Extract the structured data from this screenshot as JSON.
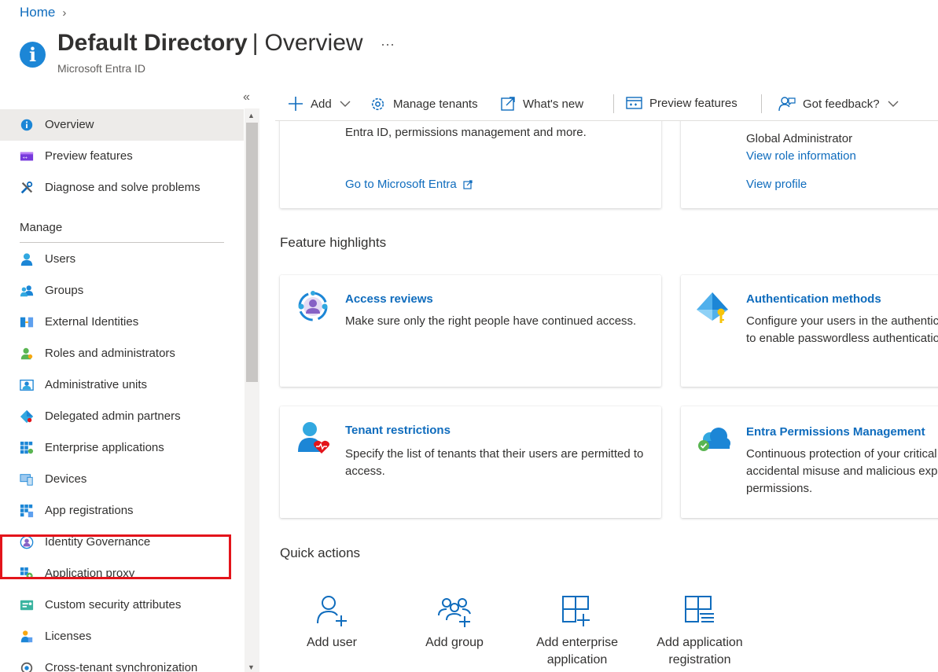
{
  "breadcrumb": {
    "home": "Home",
    "separator": "›"
  },
  "header": {
    "title_bold": "Default Directory",
    "title_pipe": "|",
    "title_rest": "Overview",
    "more": "···",
    "subtitle": "Microsoft Entra ID"
  },
  "sidebar": {
    "collapse": "«",
    "items": [
      {
        "label": "Overview",
        "icon": "info-icon"
      },
      {
        "label": "Preview features",
        "icon": "preview-icon"
      },
      {
        "label": "Diagnose and solve problems",
        "icon": "wrench-icon"
      }
    ],
    "manage_heading": "Manage",
    "manage_items": [
      {
        "label": "Users",
        "icon": "user-icon"
      },
      {
        "label": "Groups",
        "icon": "groups-icon"
      },
      {
        "label": "External Identities",
        "icon": "external-identities-icon"
      },
      {
        "label": "Roles and administrators",
        "icon": "roles-icon"
      },
      {
        "label": "Administrative units",
        "icon": "admin-units-icon"
      },
      {
        "label": "Delegated admin partners",
        "icon": "partners-icon"
      },
      {
        "label": "Enterprise applications",
        "icon": "enterprise-apps-icon"
      },
      {
        "label": "Devices",
        "icon": "devices-icon"
      },
      {
        "label": "App registrations",
        "icon": "app-registrations-icon"
      },
      {
        "label": "Identity Governance",
        "icon": "identity-governance-icon"
      },
      {
        "label": "Application proxy",
        "icon": "app-proxy-icon"
      },
      {
        "label": "Custom security attributes",
        "icon": "security-attributes-icon"
      },
      {
        "label": "Licenses",
        "icon": "licenses-icon"
      },
      {
        "label": "Cross-tenant synchronization",
        "icon": "sync-icon"
      }
    ]
  },
  "toolbar": {
    "add": "Add",
    "manage_tenants": "Manage tenants",
    "whats_new": "What's new",
    "preview_features": "Preview features",
    "got_feedback": "Got feedback?"
  },
  "top_cards": {
    "entra_desc": "Entra ID, permissions management and more.",
    "entra_link": "Go to Microsoft Entra",
    "role": "Global Administrator",
    "view_role": "View role information",
    "view_profile": "View profile"
  },
  "feature_highlights": {
    "heading": "Feature highlights",
    "cards": [
      {
        "title": "Access reviews",
        "desc": "Make sure only the right people have continued access."
      },
      {
        "title": "Authentication methods",
        "desc": "Configure your users in the authentication methods policy to enable passwordless authentication."
      },
      {
        "title": "Tenant restrictions",
        "desc": "Specify the list of tenants that their users are permitted to access."
      },
      {
        "title": "Entra Permissions Management",
        "desc": "Continuous protection of your critical cloud resources from accidental misuse and malicious exploitation of permissions."
      }
    ]
  },
  "quick_actions": {
    "heading": "Quick actions",
    "items": [
      {
        "label_1": "Add user",
        "label_2": ""
      },
      {
        "label_1": "Add group",
        "label_2": ""
      },
      {
        "label_1": "Add enterprise",
        "label_2": "application"
      },
      {
        "label_1": "Add application",
        "label_2": "registration"
      }
    ]
  }
}
